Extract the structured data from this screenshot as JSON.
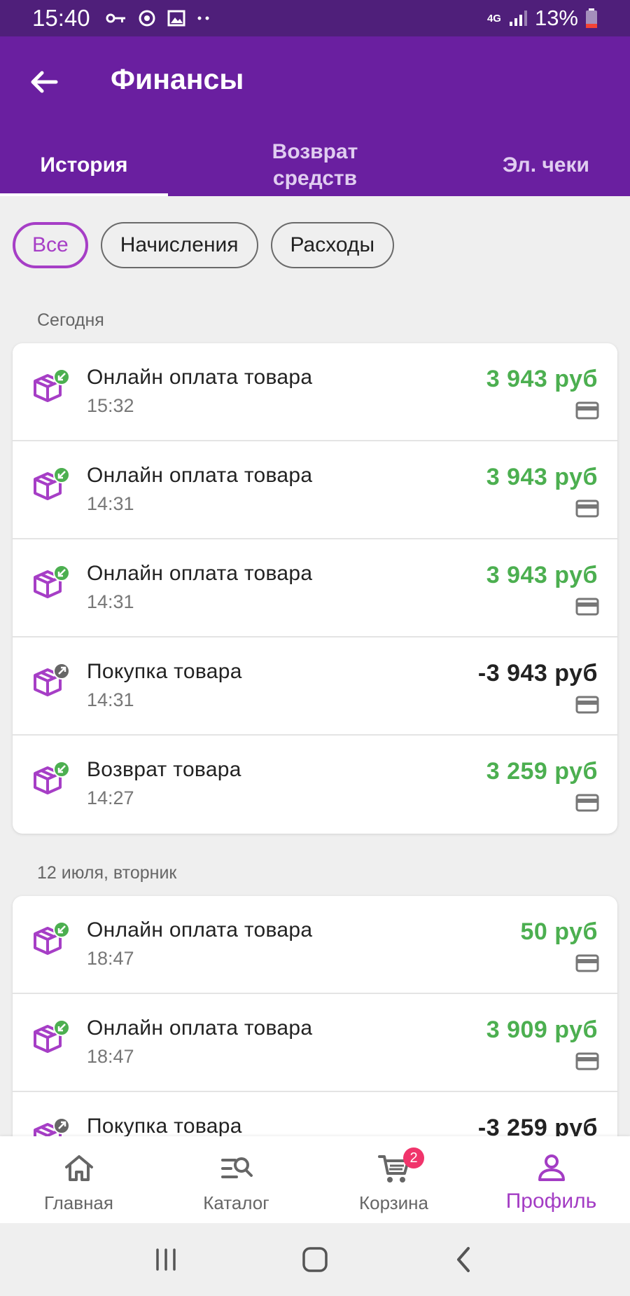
{
  "status_bar": {
    "time": "15:40",
    "network": "4G",
    "battery": "13%"
  },
  "header": {
    "title": "Финансы"
  },
  "tabs": [
    {
      "label": "История",
      "active": true
    },
    {
      "label": "Возврат средств",
      "active": false
    },
    {
      "label": "Эл. чеки",
      "active": false
    }
  ],
  "filters": [
    {
      "label": "Все",
      "active": true
    },
    {
      "label": "Начисления",
      "active": false
    },
    {
      "label": "Расходы",
      "active": false
    }
  ],
  "groups": [
    {
      "date_label": "Сегодня",
      "items": [
        {
          "title": "Онлайн оплата товара",
          "time": "15:32",
          "amount": "3 943 руб",
          "direction": "in"
        },
        {
          "title": "Онлайн оплата товара",
          "time": "14:31",
          "amount": "3 943 руб",
          "direction": "in"
        },
        {
          "title": "Онлайн оплата товара",
          "time": "14:31",
          "amount": "3 943 руб",
          "direction": "in"
        },
        {
          "title": "Покупка товара",
          "time": "14:31",
          "amount": "-3 943 руб",
          "direction": "out"
        },
        {
          "title": "Возврат товара",
          "time": "14:27",
          "amount": "3 259 руб",
          "direction": "in"
        }
      ]
    },
    {
      "date_label": "12 июля, вторник",
      "items": [
        {
          "title": "Онлайн оплата товара",
          "time": "18:47",
          "amount": "50 руб",
          "direction": "in"
        },
        {
          "title": "Онлайн оплата товара",
          "time": "18:47",
          "amount": "3 909 руб",
          "direction": "in"
        },
        {
          "title": "Покупка товара",
          "time": "",
          "amount": "-3 259 руб",
          "direction": "out"
        }
      ]
    }
  ],
  "bottom_nav": [
    {
      "label": "Главная",
      "icon": "home-icon",
      "active": false
    },
    {
      "label": "Каталог",
      "icon": "catalog-search-icon",
      "active": false
    },
    {
      "label": "Корзина",
      "icon": "cart-icon",
      "active": false,
      "badge": "2"
    },
    {
      "label": "Профиль",
      "icon": "profile-icon",
      "active": true
    }
  ],
  "colors": {
    "header": "#6a1fa0",
    "status_bar": "#4f1f7a",
    "accent": "#a33cc4",
    "income": "#4caf50",
    "expense": "#222222",
    "badge": "#f0346b"
  }
}
